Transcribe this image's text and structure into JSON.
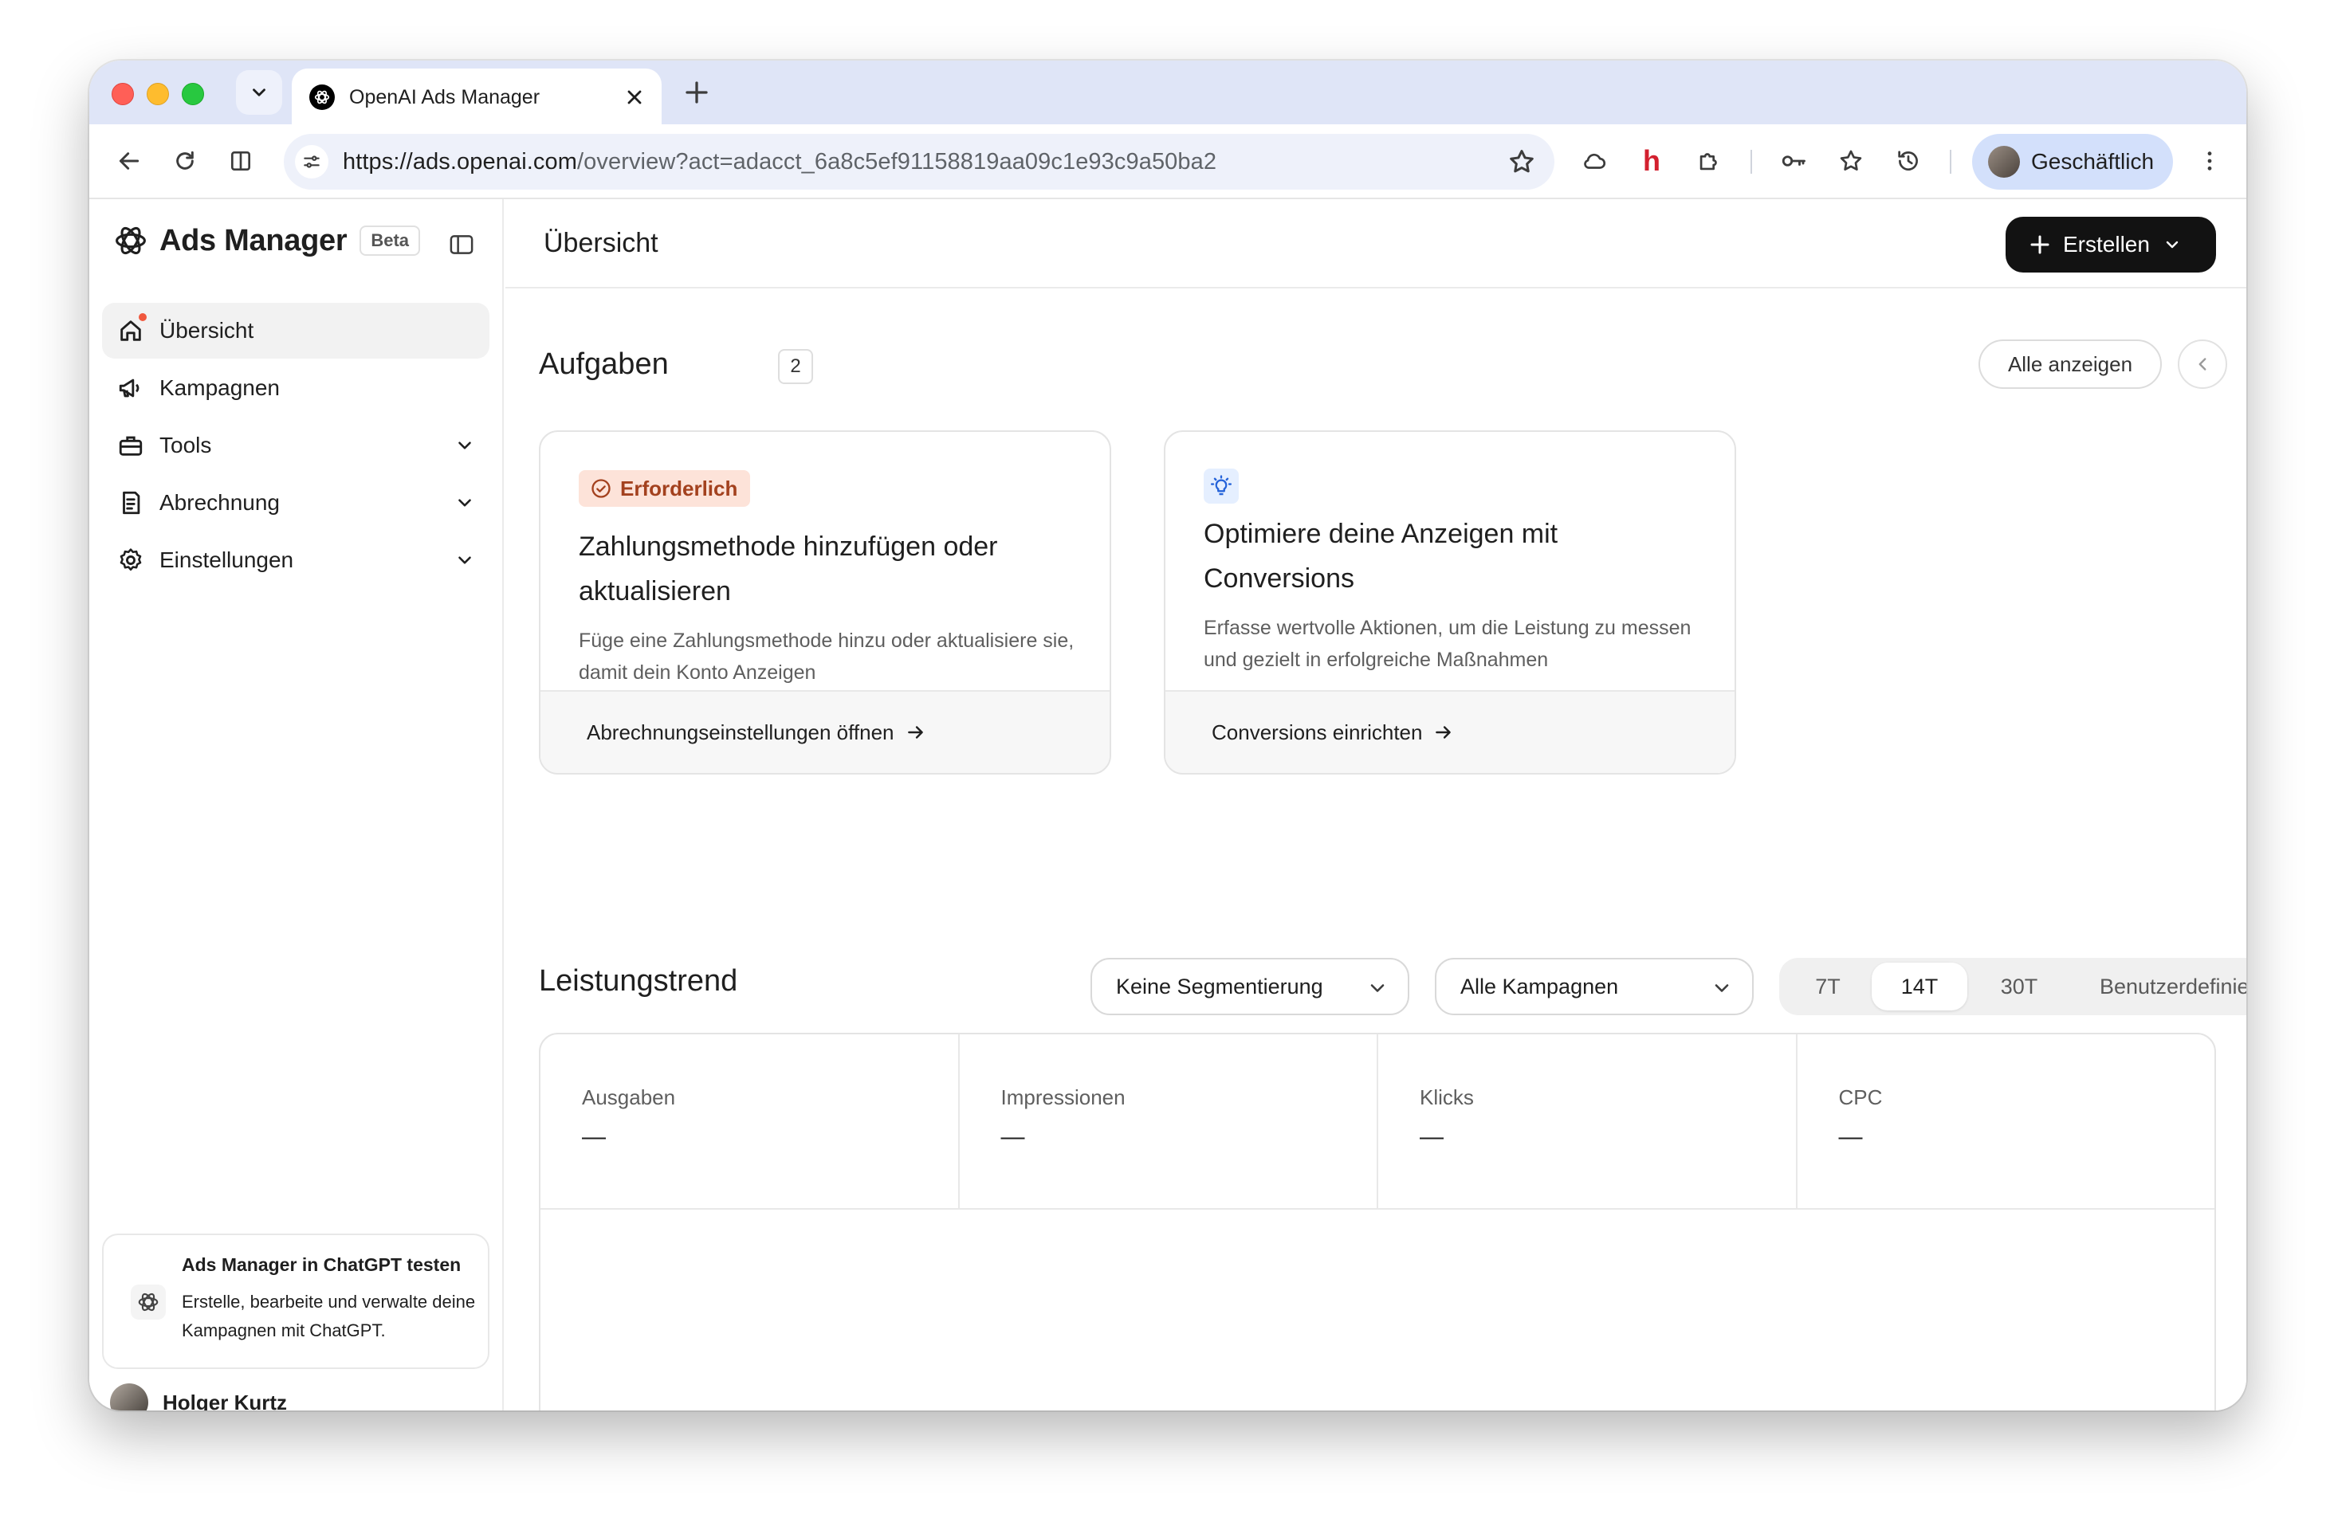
{
  "browser": {
    "tab_title": "OpenAI Ads Manager",
    "url_host": "https://ads.openai.com",
    "url_rest": "/overview?act=adacct_6a8c5ef91158819aa09c1e93c9a50ba2",
    "profile_label": "Geschäftlich",
    "extension_letter": "h"
  },
  "sidebar": {
    "brand": "Ads Manager",
    "badge": "Beta",
    "items": [
      {
        "label": "Übersicht",
        "icon": "home-icon",
        "active": true
      },
      {
        "label": "Kampagnen",
        "icon": "megaphone-icon"
      },
      {
        "label": "Tools",
        "icon": "toolbox-icon"
      },
      {
        "label": "Abrechnung",
        "icon": "receipt-icon"
      },
      {
        "label": "Einstellungen",
        "icon": "gear-icon"
      }
    ],
    "promo": {
      "title": "Ads Manager in ChatGPT testen",
      "text": "Erstelle, bearbeite und verwalte deine Kampagnen mit ChatGPT."
    },
    "user_name": "Holger Kurtz"
  },
  "main": {
    "page_title": "Übersicht",
    "create_label": "Erstellen",
    "tasks": {
      "title": "Aufgaben",
      "count": "2",
      "view_all": "Alle anzeigen",
      "cards": [
        {
          "badge": "Erforderlich",
          "title": "Zahlungsmethode hinzufügen oder aktualisieren",
          "desc": "Füge eine Zahlungsmethode hinzu oder aktualisiere sie, damit dein Konto Anzeigen",
          "link": "Abrechnungseinstellungen öffnen"
        },
        {
          "title": "Optimiere deine Anzeigen mit Conversions",
          "desc": "Erfasse wertvolle Aktionen, um die Leistung zu messen und gezielt in erfolgreiche Maßnahmen",
          "link": "Conversions einrichten"
        }
      ]
    },
    "trend": {
      "title": "Leistungstrend",
      "segmentation": "Keine Segmentierung",
      "campaigns": "Alle Kampagnen",
      "ranges": [
        "7T",
        "14T",
        "30T",
        "Benutzerdefiniert"
      ],
      "active_range": "14T",
      "metrics": [
        {
          "label": "Ausgaben",
          "value": "—"
        },
        {
          "label": "Impressionen",
          "value": "—"
        },
        {
          "label": "Klicks",
          "value": "—"
        },
        {
          "label": "CPC",
          "value": "—"
        }
      ]
    }
  },
  "colors": {
    "accent_dark": "#121212",
    "badge_bg": "#fde3d9",
    "badge_text": "#a3411e",
    "notif_dot": "#f0583e",
    "profile_chip": "#d3e0fb",
    "tabstrip": "#dfe5f7"
  }
}
